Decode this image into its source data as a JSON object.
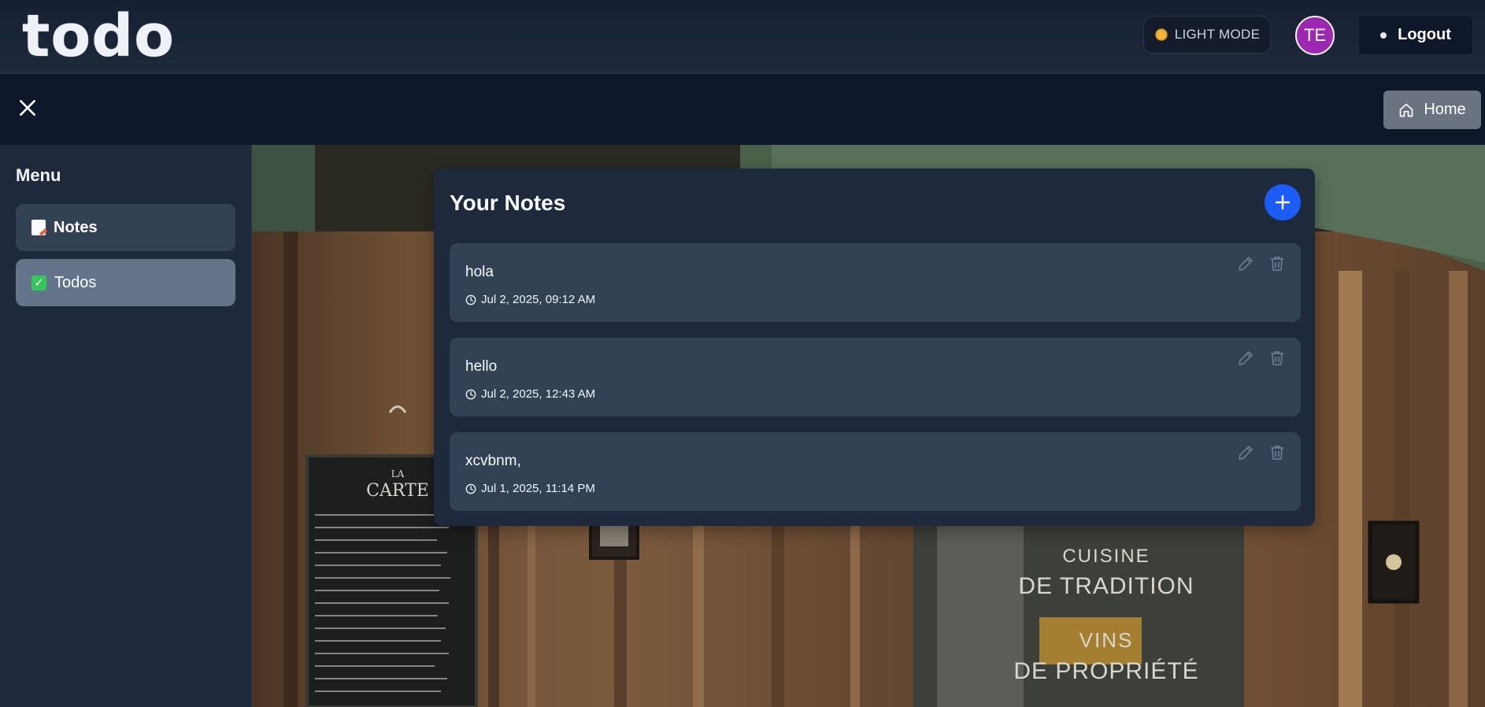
{
  "header": {
    "logo": "todo",
    "mode_toggle_label": "LIGHT MODE",
    "avatar_initials": "TE",
    "logout_label": "Logout"
  },
  "subbar": {
    "home_label": "Home"
  },
  "sidebar": {
    "title": "Menu",
    "items": [
      {
        "label": "Notes",
        "icon": "notepad-icon",
        "active": true
      },
      {
        "label": "Todos",
        "icon": "check-box-icon",
        "active": false
      }
    ]
  },
  "notes_panel": {
    "title": "Your Notes",
    "notes": [
      {
        "title": "hola",
        "timestamp": "Jul 2, 2025, 09:12 AM"
      },
      {
        "title": "hello",
        "timestamp": "Jul 2, 2025, 12:43 AM"
      },
      {
        "title": "xcvbnm,",
        "timestamp": "Jul 1, 2025, 11:14 PM"
      }
    ]
  },
  "background_sign": {
    "menu_board_heading_1": "LA",
    "menu_board_heading_2": "CARTE",
    "window_text_1": "CUISINE",
    "window_text_2": "DE TRADITION",
    "window_text_3": "VINS",
    "window_text_4": "DE PROPRIÉTÉ"
  },
  "colors": {
    "accent_blue": "#1a5cf5",
    "avatar_purple": "#9c27b0",
    "panel_bg": "#1e293b",
    "card_bg": "#334155"
  }
}
